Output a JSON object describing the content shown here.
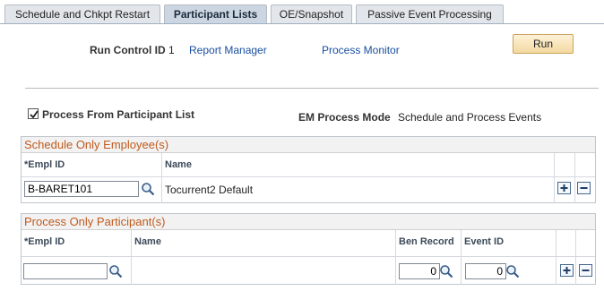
{
  "tabs": [
    {
      "label": "Schedule and Chkpt Restart",
      "active": false
    },
    {
      "label": "Participant Lists",
      "active": true
    },
    {
      "label": "OE/Snapshot",
      "active": false
    },
    {
      "label": "Passive Event Processing",
      "active": false
    }
  ],
  "header": {
    "run_control_label": "Run Control ID",
    "run_control_value": "1",
    "report_manager": "Report Manager",
    "process_monitor": "Process Monitor",
    "run_button": "Run"
  },
  "options": {
    "process_from_list_label": "Process From Participant List",
    "process_from_list_checked": true,
    "em_mode_label": "EM Process Mode",
    "em_mode_value": "Schedule and Process Events"
  },
  "schedule_grid": {
    "title": "Schedule Only Employee(s)",
    "columns": [
      "*Empl ID",
      "Name"
    ],
    "rows": [
      {
        "empl_id": "B-BARET101",
        "name": "Tocurrent2 Default"
      }
    ]
  },
  "process_grid": {
    "title": "Process Only Participant(s)",
    "columns": [
      "*Empl ID",
      "Name",
      "Ben Record",
      "Event ID"
    ],
    "rows": [
      {
        "empl_id": "",
        "name": "",
        "ben_record": "0",
        "event_id": "0"
      }
    ]
  },
  "colors": {
    "grid_title": "#c05a1c",
    "link": "#1a4fa0",
    "run_button": "#f4d9a0"
  },
  "icons": {
    "lookup": "magnifying-glass-icon",
    "add_row": "plus-icon",
    "delete_row": "minus-icon",
    "checkbox": "checkmark-icon"
  }
}
